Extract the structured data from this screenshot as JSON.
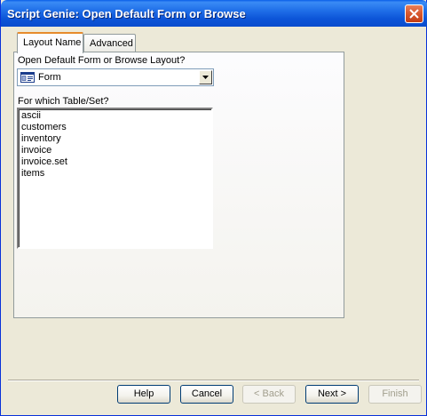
{
  "window": {
    "title": "Script Genie:  Open Default Form or Browse"
  },
  "tabs": [
    {
      "label": "Layout Name",
      "active": true
    },
    {
      "label": "Advanced",
      "active": false
    }
  ],
  "layout_field": {
    "label": "Open Default Form or Browse Layout?",
    "value": "Form",
    "icon": "form-icon"
  },
  "table_field": {
    "label": "For which Table/Set?",
    "items": [
      "ascii",
      "customers",
      "inventory",
      "invoice",
      "invoice.set",
      "items"
    ]
  },
  "buttons": {
    "help": "Help",
    "cancel": "Cancel",
    "back": "< Back",
    "next": "Next >",
    "finish": "Finish"
  },
  "colors": {
    "title_bar": "#0a55d8",
    "close_button": "#d95a30",
    "dialog_face": "#ece9d8",
    "active_tab_accent": "#e68b2c"
  }
}
